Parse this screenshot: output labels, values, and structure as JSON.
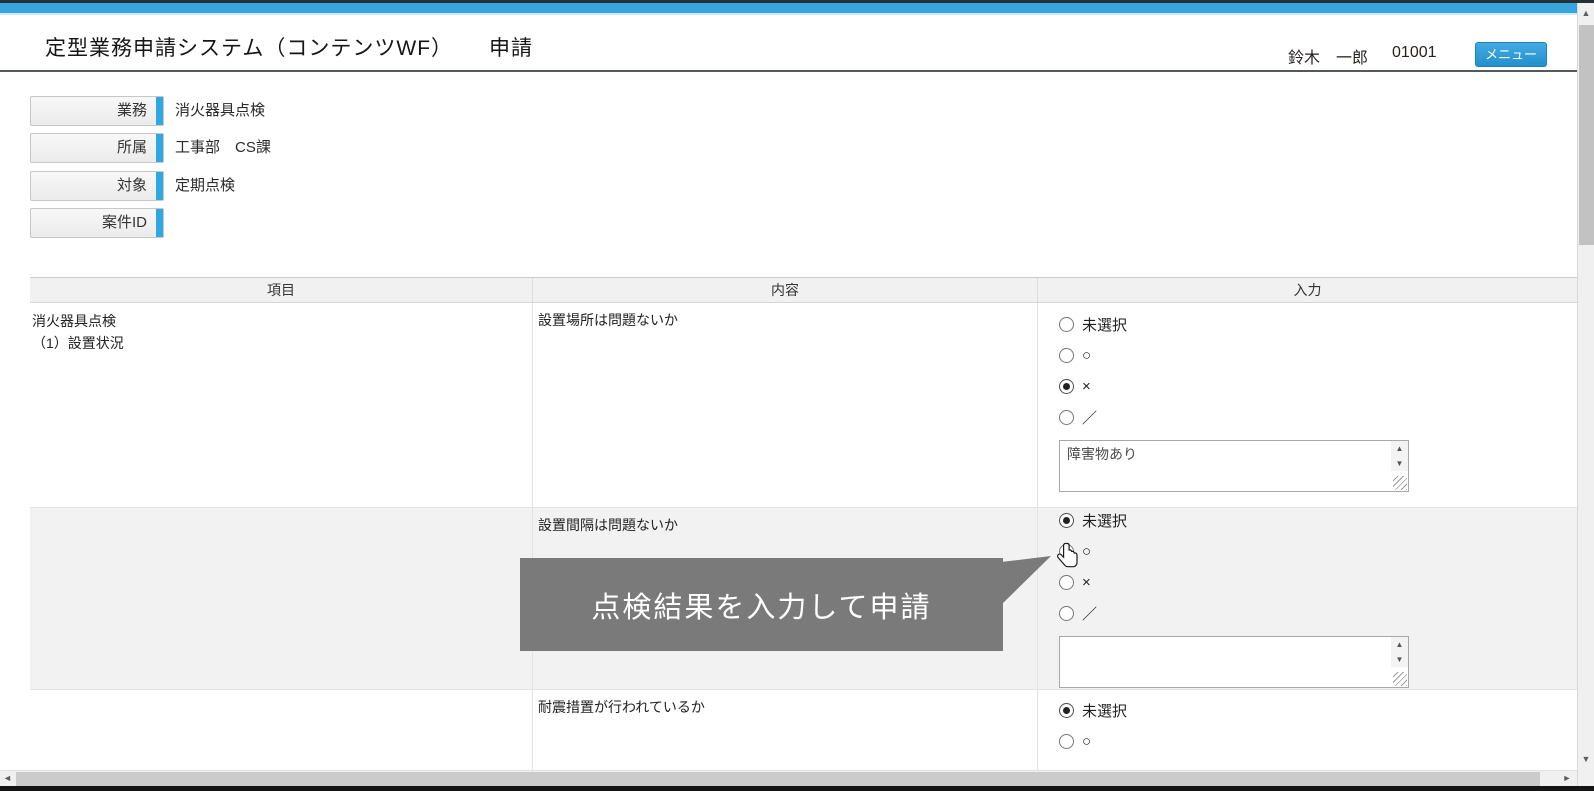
{
  "header": {
    "system_title": "定型業務申請システム（コンテンツWF）",
    "page_title": "申請",
    "user_name": "鈴木　一郎",
    "user_id": "01001",
    "menu_button": "メニュー"
  },
  "info_fields": [
    {
      "label": "業務",
      "value": "消火器具点検"
    },
    {
      "label": "所属",
      "value": "工事部　CS課"
    },
    {
      "label": "対象",
      "value": "定期点検"
    },
    {
      "label": "案件ID",
      "value": ""
    }
  ],
  "table": {
    "columns": [
      "項目",
      "内容",
      "入力"
    ],
    "rows": [
      {
        "item_line1": "消火器具点検",
        "item_line2": "（1）設置状況",
        "question": "設置場所は問題ないか",
        "options": [
          "未選択",
          "○",
          "×",
          "／"
        ],
        "selected_option": "×",
        "selected_index": 2,
        "comment": "障害物あり"
      },
      {
        "item_line1": "",
        "item_line2": "",
        "question": "設置間隔は問題ないか",
        "options": [
          "未選択",
          "○",
          "×",
          "／"
        ],
        "selected_option": "未選択",
        "selected_index": 0,
        "comment": ""
      },
      {
        "item_line1": "",
        "item_line2": "",
        "question": "耐震措置が行われているか",
        "options": [
          "未選択",
          "○"
        ],
        "selected_option": "未選択",
        "selected_index": 0
      }
    ]
  },
  "tooltip": {
    "text": "点検結果を入力して申請",
    "background": "#7a7a7a"
  },
  "icons": {
    "up": "▲",
    "down": "▼",
    "left": "◄",
    "right": "►"
  },
  "colors": {
    "topbar_blue": "#36a5de",
    "accent_blue": "#2fa8e1",
    "menu_button_blue": "#2e9bd5",
    "row_stripe": "#f2f2f2"
  }
}
